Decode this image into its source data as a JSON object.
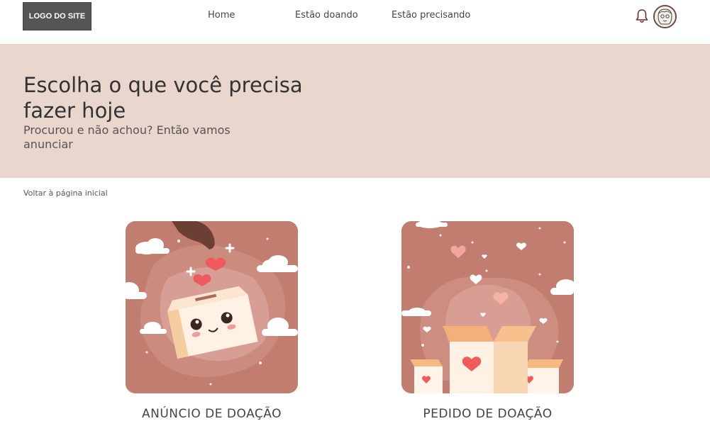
{
  "header": {
    "logo": "LOGO DO SITE",
    "nav": {
      "home": "Home",
      "donating": "Estão doando",
      "needing": "Estão precisando"
    },
    "icons": {
      "notifications": "bell-icon",
      "profile": "avatar"
    }
  },
  "hero": {
    "title": "Escolha o que você precisa fazer hoje",
    "subtitle": "Procurou e não achou? Então vamos anunciar",
    "background": "#e9d6cd"
  },
  "back_link": "Voltar à página inicial",
  "cards": [
    {
      "label": "ANÚNCIO DE DOAÇÃO",
      "illustration": "donation-box-illustration"
    },
    {
      "label": "PEDIDO DE DOAÇÃO",
      "illustration": "gift-boxes-hearts-illustration"
    }
  ],
  "colors": {
    "card_bg": "#c17d70",
    "logo_bg": "#555555",
    "heart": "#f05a5a"
  }
}
